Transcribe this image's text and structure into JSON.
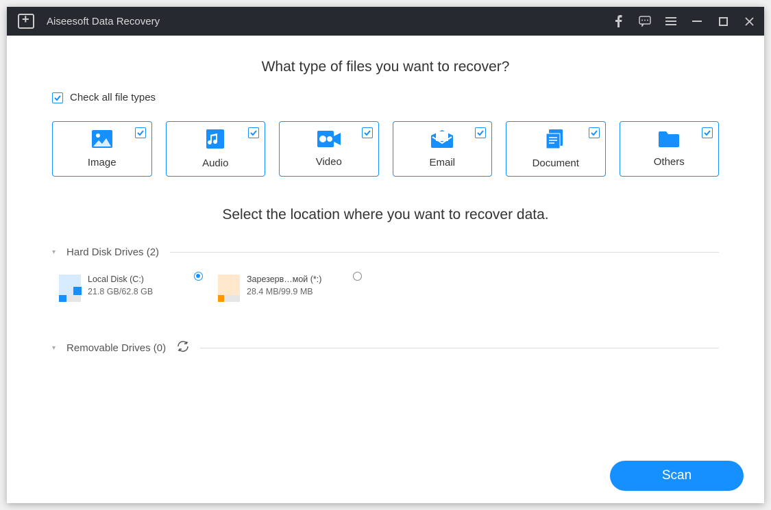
{
  "app": {
    "title": "Aiseesoft Data Recovery"
  },
  "headings": {
    "file_types": "What type of files you want to recover?",
    "check_all": "Check all file types",
    "location": "Select the location where you want to recover data."
  },
  "file_types": [
    {
      "label": "Image",
      "icon": "image-icon"
    },
    {
      "label": "Audio",
      "icon": "audio-icon"
    },
    {
      "label": "Video",
      "icon": "video-icon"
    },
    {
      "label": "Email",
      "icon": "email-icon"
    },
    {
      "label": "Document",
      "icon": "document-icon"
    },
    {
      "label": "Others",
      "icon": "folder-icon"
    }
  ],
  "sections": {
    "hdd": "Hard Disk Drives (2)",
    "removable": "Removable Drives (0)"
  },
  "drives": [
    {
      "name": "Local Disk (C:)",
      "size": "21.8 GB/62.8 GB",
      "selected": true,
      "color": "blue",
      "usage_pct": 35
    },
    {
      "name": "Зарезерв…мой (*:)",
      "size": "28.4 MB/99.9 MB",
      "selected": false,
      "color": "orange",
      "usage_pct": 28
    }
  ],
  "buttons": {
    "scan": "Scan"
  }
}
